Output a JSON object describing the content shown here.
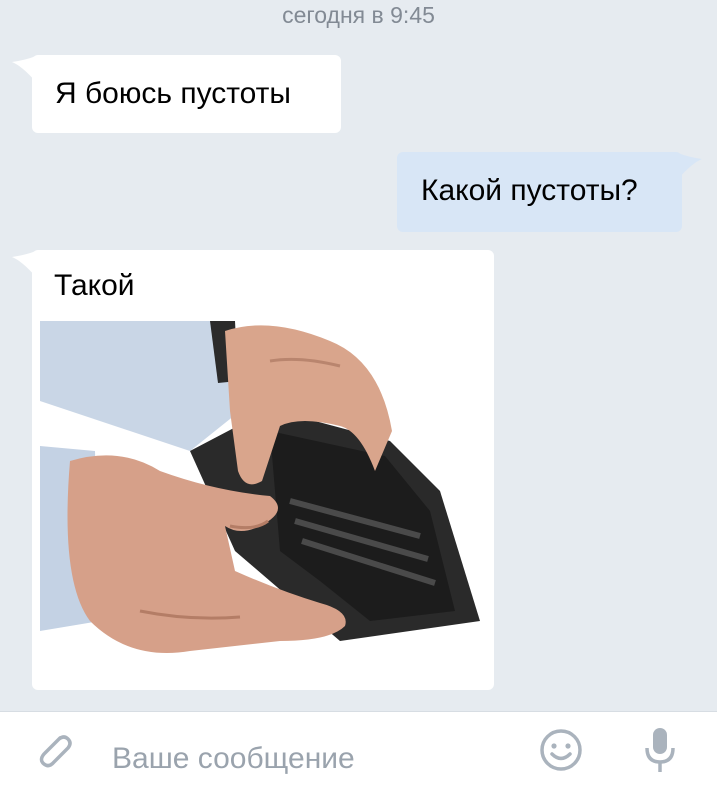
{
  "chat": {
    "date_label": "сегодня в 9:45",
    "messages": [
      {
        "direction": "incoming",
        "text": "Я боюсь пустоты"
      },
      {
        "direction": "outgoing",
        "text": "Какой пустоты?"
      },
      {
        "direction": "incoming",
        "text": "Такой",
        "attachment": "photo-empty-wallet"
      }
    ]
  },
  "composer": {
    "placeholder": "Ваше сообщение",
    "icons": {
      "attach": "paperclip-icon",
      "emoji": "smiley-icon",
      "voice": "microphone-icon"
    }
  },
  "colors": {
    "background": "#e6ebf0",
    "incoming_bubble": "#ffffff",
    "outgoing_bubble": "#d8e6f6",
    "icon_gray": "#aab3bd"
  }
}
